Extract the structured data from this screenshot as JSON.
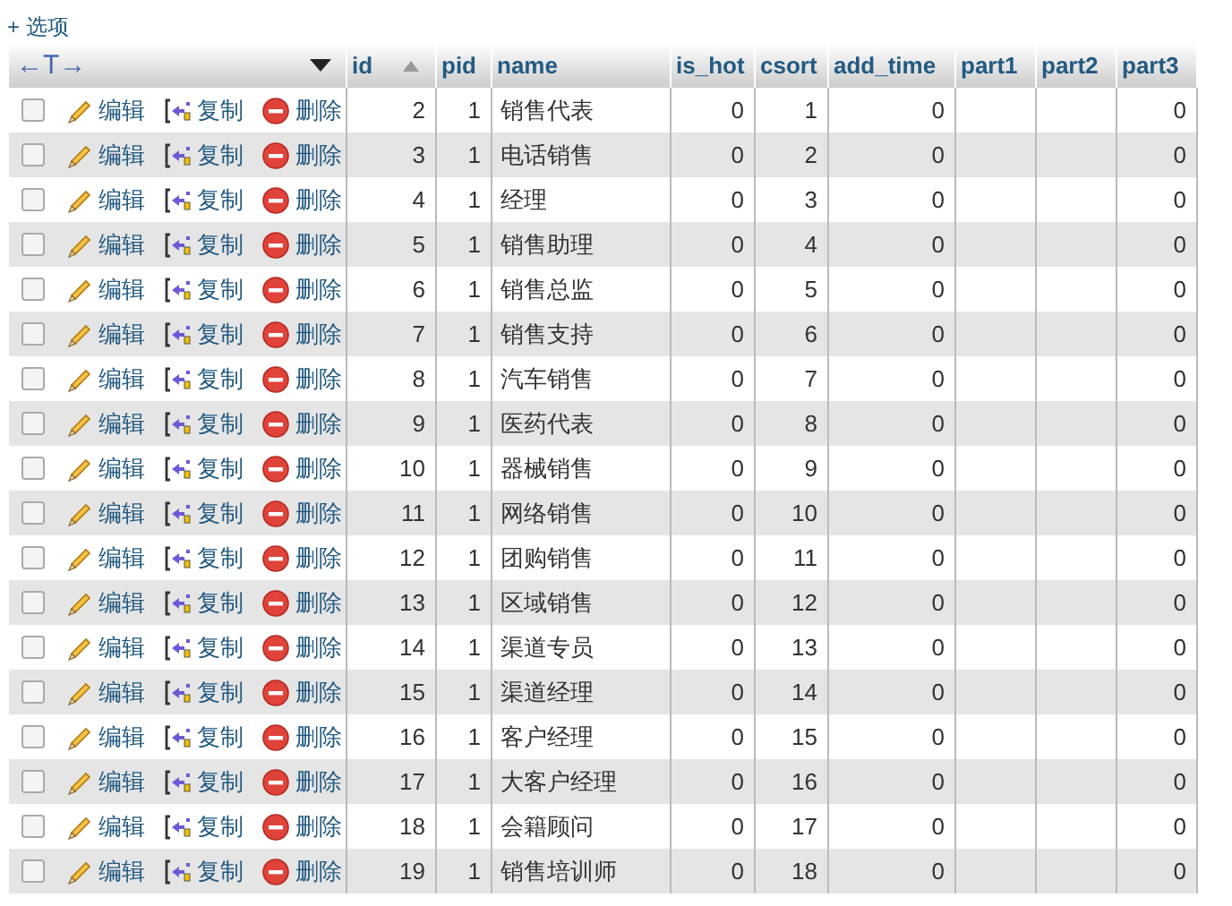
{
  "options_link": "+ 选项",
  "table": {
    "toolbar_label": "←T→",
    "columns": [
      {
        "label": "id",
        "sorted": true
      },
      {
        "label": "pid",
        "sorted": false
      },
      {
        "label": "name",
        "sorted": false
      },
      {
        "label": "is_hot",
        "sorted": false
      },
      {
        "label": "csort",
        "sorted": false
      },
      {
        "label": "add_time",
        "sorted": false
      },
      {
        "label": "part1",
        "sorted": false
      },
      {
        "label": "part2",
        "sorted": false
      },
      {
        "label": "part3",
        "sorted": false
      }
    ],
    "rows": [
      {
        "checked": false,
        "edit": "编辑",
        "copy": "复制",
        "delete": "删除",
        "id": "2",
        "pid": "1",
        "name": "销售代表",
        "is_hot": "0",
        "csort": "1",
        "add_time": "0",
        "part3": "0"
      },
      {
        "checked": false,
        "edit": "编辑",
        "copy": "复制",
        "delete": "删除",
        "id": "3",
        "pid": "1",
        "name": "电话销售",
        "is_hot": "0",
        "csort": "2",
        "add_time": "0",
        "part3": "0"
      },
      {
        "checked": false,
        "edit": "编辑",
        "copy": "复制",
        "delete": "删除",
        "id": "4",
        "pid": "1",
        "name": "经理",
        "is_hot": "0",
        "csort": "3",
        "add_time": "0",
        "part3": "0"
      },
      {
        "checked": false,
        "edit": "编辑",
        "copy": "复制",
        "delete": "删除",
        "id": "5",
        "pid": "1",
        "name": "销售助理",
        "is_hot": "0",
        "csort": "4",
        "add_time": "0",
        "part3": "0"
      },
      {
        "checked": false,
        "edit": "编辑",
        "copy": "复制",
        "delete": "删除",
        "id": "6",
        "pid": "1",
        "name": "销售总监",
        "is_hot": "0",
        "csort": "5",
        "add_time": "0",
        "part3": "0"
      },
      {
        "checked": false,
        "edit": "编辑",
        "copy": "复制",
        "delete": "删除",
        "id": "7",
        "pid": "1",
        "name": "销售支持",
        "is_hot": "0",
        "csort": "6",
        "add_time": "0",
        "part3": "0"
      },
      {
        "checked": false,
        "edit": "编辑",
        "copy": "复制",
        "delete": "删除",
        "id": "8",
        "pid": "1",
        "name": "汽车销售",
        "is_hot": "0",
        "csort": "7",
        "add_time": "0",
        "part3": "0"
      },
      {
        "checked": false,
        "edit": "编辑",
        "copy": "复制",
        "delete": "删除",
        "id": "9",
        "pid": "1",
        "name": "医药代表",
        "is_hot": "0",
        "csort": "8",
        "add_time": "0",
        "part3": "0"
      },
      {
        "checked": false,
        "edit": "编辑",
        "copy": "复制",
        "delete": "删除",
        "id": "10",
        "pid": "1",
        "name": "器械销售",
        "is_hot": "0",
        "csort": "9",
        "add_time": "0",
        "part3": "0"
      },
      {
        "checked": false,
        "edit": "编辑",
        "copy": "复制",
        "delete": "删除",
        "id": "11",
        "pid": "1",
        "name": "网络销售",
        "is_hot": "0",
        "csort": "10",
        "add_time": "0",
        "part3": "0"
      },
      {
        "checked": false,
        "edit": "编辑",
        "copy": "复制",
        "delete": "删除",
        "id": "12",
        "pid": "1",
        "name": "团购销售",
        "is_hot": "0",
        "csort": "11",
        "add_time": "0",
        "part3": "0"
      },
      {
        "checked": false,
        "edit": "编辑",
        "copy": "复制",
        "delete": "删除",
        "id": "13",
        "pid": "1",
        "name": "区域销售",
        "is_hot": "0",
        "csort": "12",
        "add_time": "0",
        "part3": "0"
      },
      {
        "checked": false,
        "edit": "编辑",
        "copy": "复制",
        "delete": "删除",
        "id": "14",
        "pid": "1",
        "name": "渠道专员",
        "is_hot": "0",
        "csort": "13",
        "add_time": "0",
        "part3": "0"
      },
      {
        "checked": false,
        "edit": "编辑",
        "copy": "复制",
        "delete": "删除",
        "id": "15",
        "pid": "1",
        "name": "渠道经理",
        "is_hot": "0",
        "csort": "14",
        "add_time": "0",
        "part3": "0"
      },
      {
        "checked": false,
        "edit": "编辑",
        "copy": "复制",
        "delete": "删除",
        "id": "16",
        "pid": "1",
        "name": "客户经理",
        "is_hot": "0",
        "csort": "15",
        "add_time": "0",
        "part3": "0"
      },
      {
        "checked": false,
        "edit": "编辑",
        "copy": "复制",
        "delete": "删除",
        "id": "17",
        "pid": "1",
        "name": "大客户经理",
        "is_hot": "0",
        "csort": "16",
        "add_time": "0",
        "part3": "0"
      },
      {
        "checked": false,
        "edit": "编辑",
        "copy": "复制",
        "delete": "删除",
        "id": "18",
        "pid": "1",
        "name": "会籍顾问",
        "is_hot": "0",
        "csort": "17",
        "add_time": "0",
        "part3": "0"
      },
      {
        "checked": false,
        "edit": "编辑",
        "copy": "复制",
        "delete": "删除",
        "id": "19",
        "pid": "1",
        "name": "销售培训师",
        "is_hot": "0",
        "csort": "18",
        "add_time": "0",
        "part3": "0"
      }
    ]
  }
}
